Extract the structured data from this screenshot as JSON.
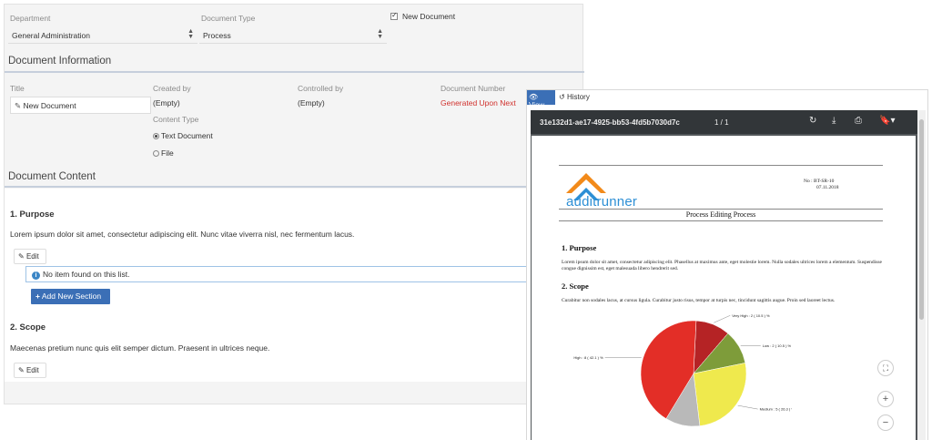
{
  "form": {
    "department": {
      "label": "Department",
      "value": "General Administration"
    },
    "document_type": {
      "label": "Document Type",
      "value": "Process"
    },
    "new_document": {
      "label": "New Document",
      "checked": true
    },
    "info_section_title": "Document Information",
    "title": {
      "label": "Title",
      "value": "New Document"
    },
    "created_by": {
      "label": "Created by",
      "value": "(Empty)"
    },
    "controlled_by": {
      "label": "Controlled by",
      "value": "(Empty)"
    },
    "document_number": {
      "label": "Document Number",
      "value": "Generated Upon Next"
    },
    "content_type": {
      "label": "Content Type",
      "options": [
        "Text Document",
        "File"
      ],
      "selected": "Text Document"
    },
    "content_section_title": "Document Content",
    "sections": [
      {
        "heading": "1.  Purpose",
        "text": "Lorem ipsum dolor sit amet, consectetur adipiscing elit. Nunc vitae viverra nisl, nec fermentum lacus.",
        "edit_label": "Edit"
      },
      {
        "heading": "2.  Scope",
        "text": "Maecenas pretium nunc quis elit semper dictum. Praesent in ultrices neque.",
        "edit_label": "Edit"
      }
    ],
    "empty_list_message": "No item found on this list.",
    "add_section_label": "Add New Section"
  },
  "viewer": {
    "tabs": [
      "View",
      "History"
    ],
    "active_tab": "View",
    "file_name": "31e132d1-ae17-4925-bb53-4fd5b7030d7c",
    "page_indicator": "1 / 1",
    "toolbar_icons": [
      "rotate-icon",
      "download-icon",
      "print-icon",
      "bookmark-icon"
    ],
    "zoom_controls": [
      "fit-page-icon",
      "zoom-in-icon",
      "zoom-out-icon"
    ],
    "pdf": {
      "logo_text": "auditrunner",
      "doc_no": "No : BT-SR-10",
      "doc_date": "07.11.2018",
      "doc_title": "Process Editing Process",
      "purpose_heading": "1. Purpose",
      "purpose_text": "Lorem ipsum dolor sit amet, consectetur adipiscing elit. Phasellus at maximus ante, eget molestie lorem. Nulla sodales ultrices lorem a elementum. Suspendisse congue dignissim est, eget malesuada libero hendrerit sed.",
      "scope_heading": "2. Scope",
      "scope_text": "Curabitur non sodales lacus, at cursus ligula. Curabitur justo risus, tempor at turpis nec, tincidunt sagittis augue. Proin sed laoreet lectus."
    },
    "colors": {
      "accent": "#3b6fb6",
      "toolbar": "#323639"
    }
  },
  "chart_data": {
    "type": "pie",
    "slices": [
      {
        "label": "Very High : 2 ( 10.5 ) %",
        "value": 10.5,
        "color": "#b52325"
      },
      {
        "label": "Low : 2 ( 10.5 ) %",
        "value": 10.5,
        "color": "#7e9c3a"
      },
      {
        "label": "Medium : 5 ( 26.3 ) %",
        "value": 26.3,
        "color": "#efe94d"
      },
      {
        "label": "",
        "value": 10.6,
        "color": "#b9b9b9"
      },
      {
        "label": "High : 8 ( 42.1 ) %",
        "value": 42.1,
        "color": "#e32e27"
      }
    ]
  }
}
